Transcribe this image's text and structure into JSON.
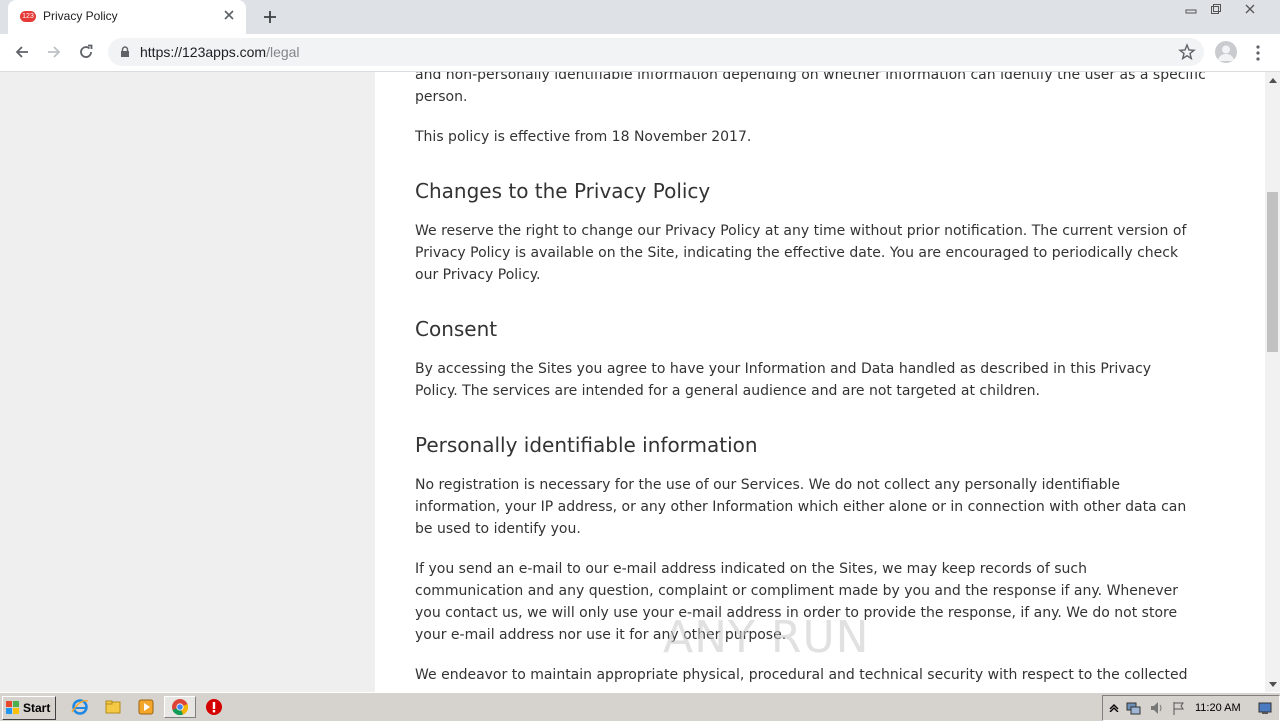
{
  "browser": {
    "tab": {
      "title": "Privacy Policy",
      "favicon_text": "123"
    },
    "url": {
      "host": "https://123apps.com",
      "path": "/legal"
    }
  },
  "page": {
    "intro_tail_line1": "and non-personally identifiable information depending on whether information can identify the user as a specific",
    "intro_tail_line2": "person.",
    "effective": "This policy is effective from 18 November 2017.",
    "sections": [
      {
        "heading": "Changes to the Privacy Policy",
        "body": "We reserve the right to change our Privacy Policy at any time without prior notification. The current version of Privacy Policy is available on the Site, indicating the effective date. You are encouraged to periodically check our Privacy Policy."
      },
      {
        "heading": "Consent",
        "body": "By accessing the Sites you agree to have your Information and Data handled as described in this Privacy Policy. The services are intended for a general audience and are not targeted at children."
      },
      {
        "heading": "Personally identifiable information",
        "body": "No registration is necessary for the use of our Services. We do not collect any personally identifiable information, your IP address, or any other Information which either alone or in connection with other data can be used to identify you.",
        "body2": "If you send an e-mail to our e-mail address indicated on the Sites, we may keep records of such communication and any question, complaint or compliment made by you and the response if any. Whenever you contact us, we will only use your e-mail address in order to provide the response, if any. We do not store your e-mail address nor use it for any other purpose.",
        "body3": "We endeavor to maintain appropriate physical, procedural and technical security with respect to the collected"
      }
    ]
  },
  "watermark": "ANY RUN",
  "taskbar": {
    "start_label": "Start",
    "clock": "11:20 AM"
  },
  "colors": {
    "tab_strip": "#dee1e6",
    "favicon": "#e53935",
    "taskbar": "#d6d3ce"
  }
}
